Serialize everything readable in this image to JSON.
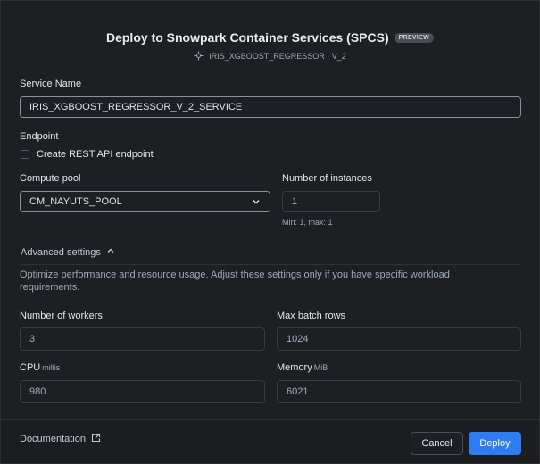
{
  "dialog": {
    "title": "Deploy to Snowpark Container Services (SPCS)",
    "badge": "PREVIEW",
    "model_icon": "model-icon",
    "model_name": "IRIS_XGBOOST_REGRESSOR · V_2"
  },
  "service": {
    "label": "Service Name",
    "value": "IRIS_XGBOOST_REGRESSOR_V_2_SERVICE"
  },
  "endpoint": {
    "label": "Endpoint",
    "checkbox_label": "Create REST API endpoint",
    "checked": false
  },
  "compute_pool": {
    "label": "Compute pool",
    "selected": "CM_NAYUTS_POOL"
  },
  "instances": {
    "label": "Number of instances",
    "value": "1",
    "hint": "Min: 1, max: 1"
  },
  "advanced": {
    "toggle_label": "Advanced settings",
    "expanded": true,
    "description": "Optimize performance and resource usage. Adjust these settings only if you have specific workload requirements.",
    "workers_label": "Number of workers",
    "workers_value": "3",
    "batch_label": "Max batch rows",
    "batch_value": "1024",
    "cpu_label": "CPU",
    "cpu_unit": "millis",
    "cpu_value": "980",
    "memory_label": "Memory",
    "memory_unit": "MiB",
    "memory_value": "6021"
  },
  "footer": {
    "doc_label": "Documentation",
    "cancel_label": "Cancel",
    "deploy_label": "Deploy"
  },
  "colors": {
    "accent": "#2d7cf2",
    "background": "#1e1f23"
  }
}
